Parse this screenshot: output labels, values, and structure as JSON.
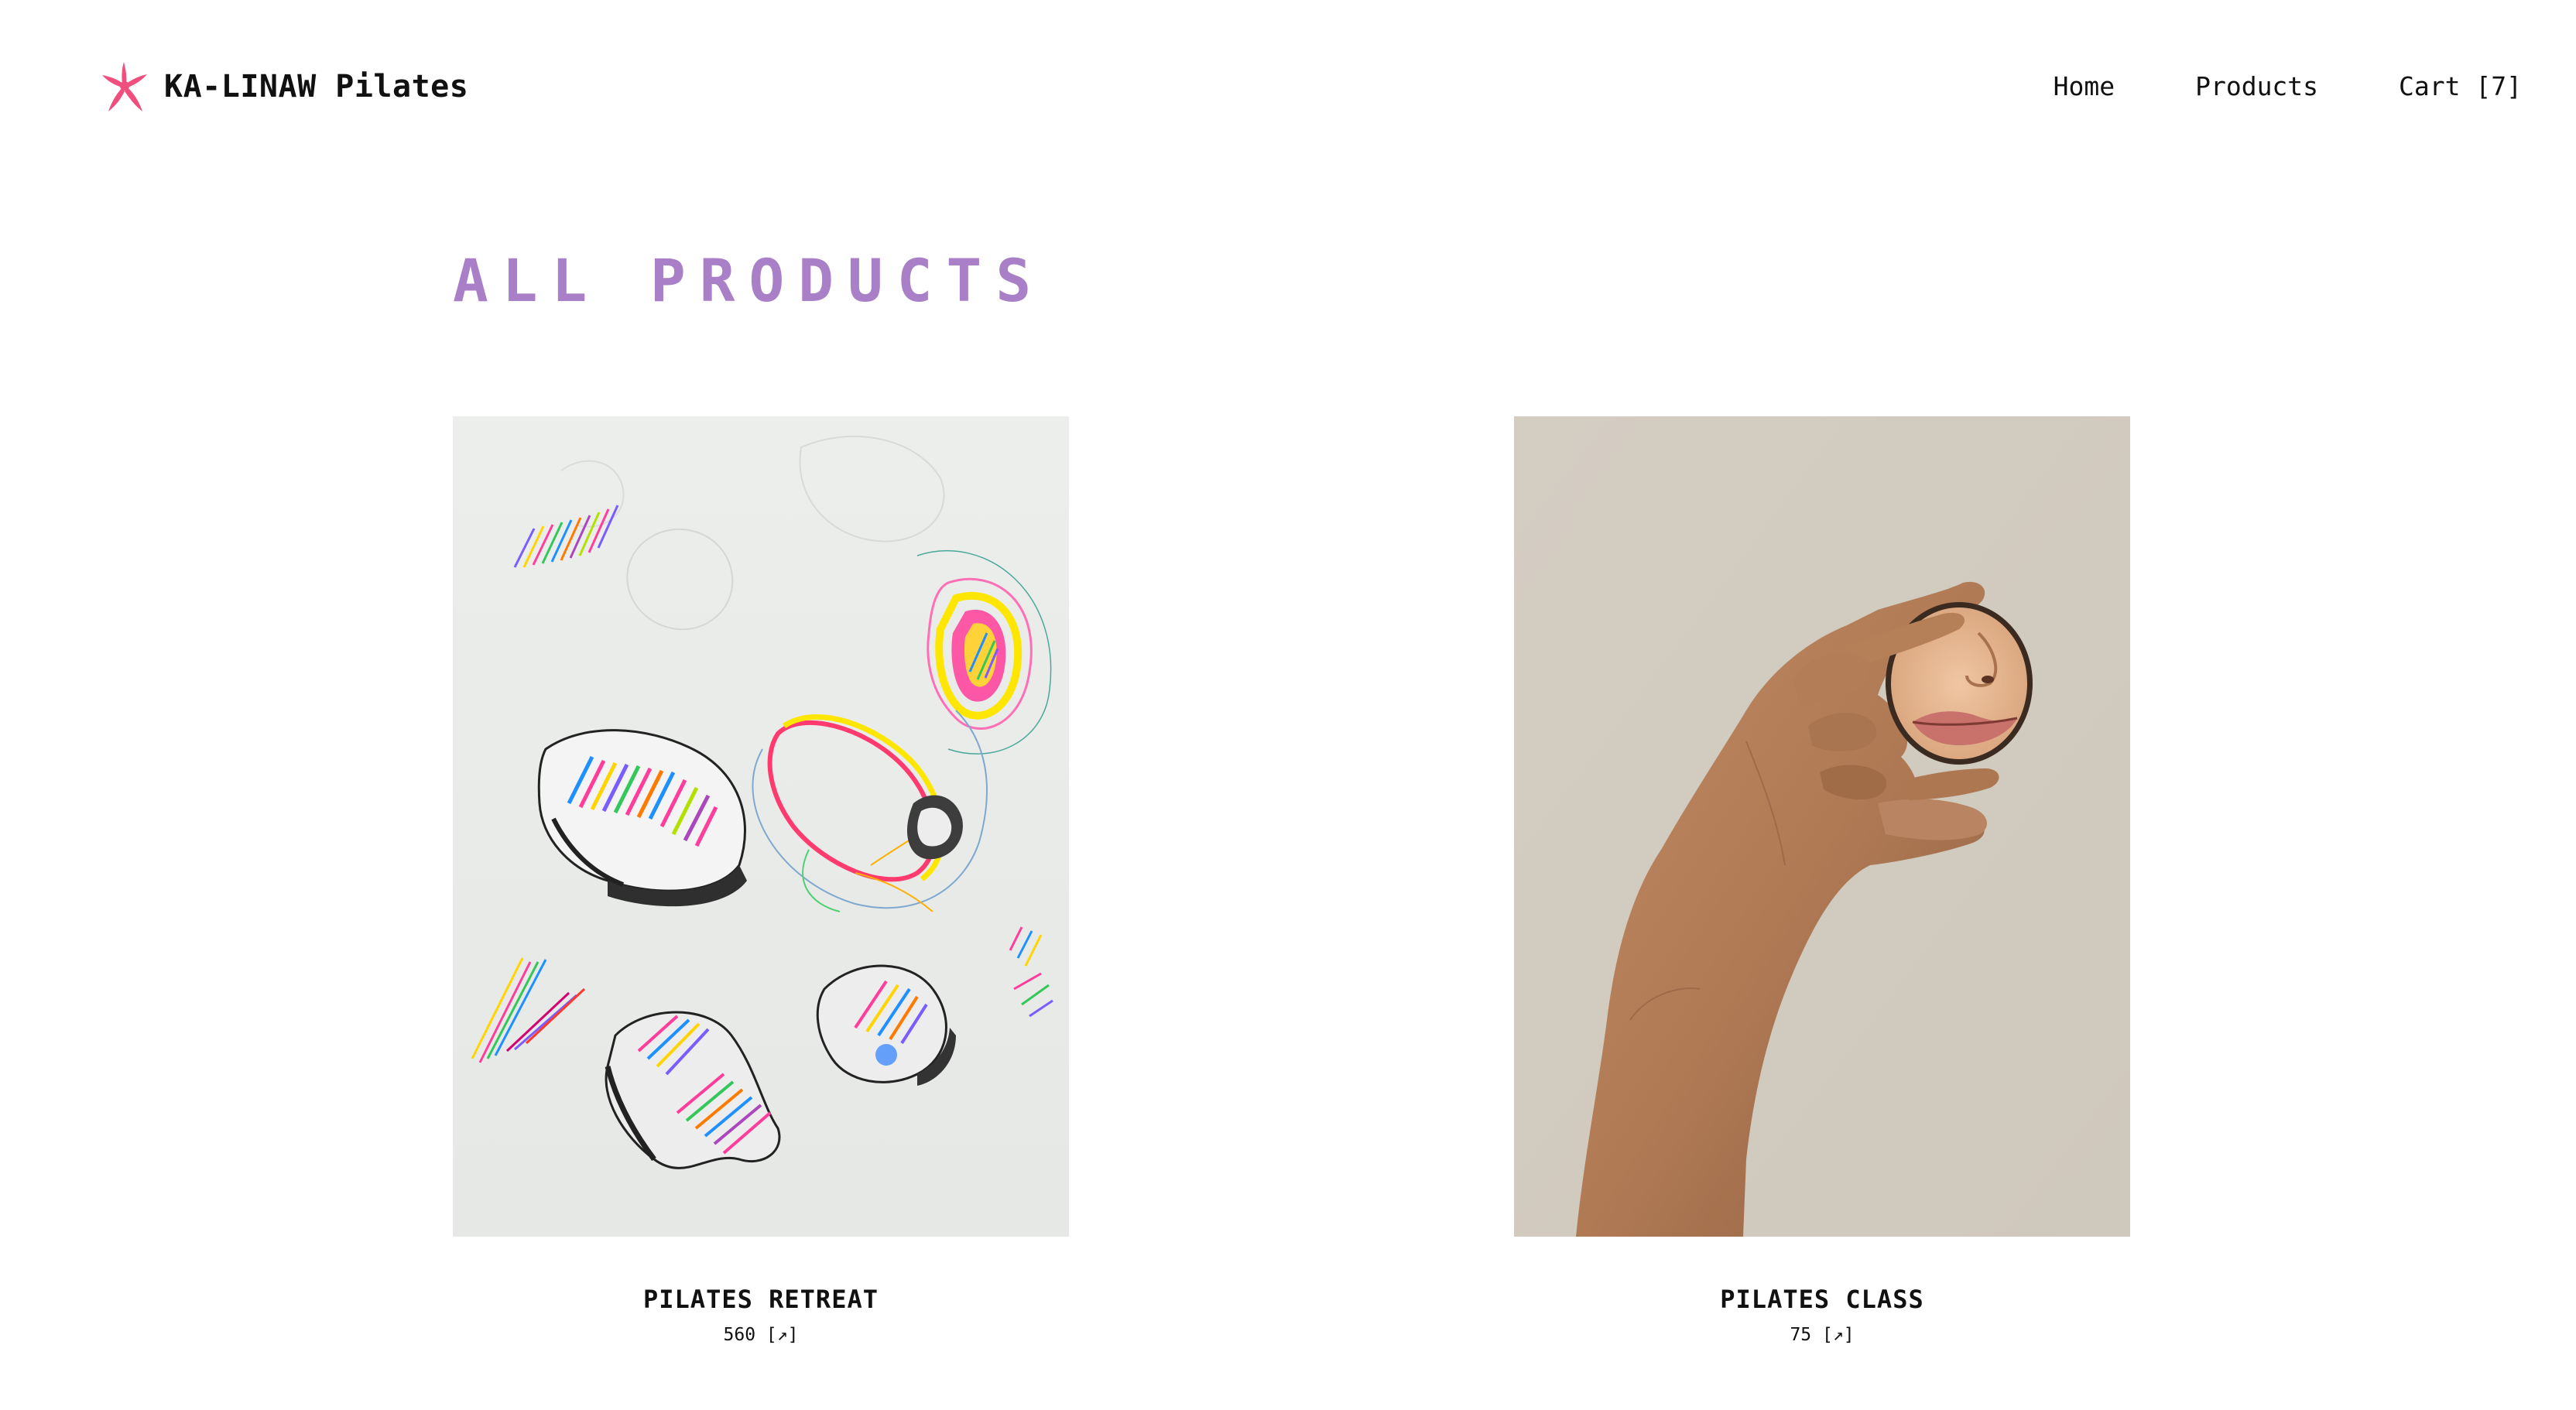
{
  "header": {
    "brand_name": "KA-LINAW Pilates",
    "logo_icon": "pink-asterisk-star-icon",
    "logo_color": "#ee4f7d",
    "nav": [
      {
        "label": "Home"
      },
      {
        "label": "Products"
      },
      {
        "label": "Cart [7]"
      }
    ]
  },
  "main": {
    "title": "ALL PRODUCTS",
    "title_color": "#a97fc7",
    "products": [
      {
        "name": "PILATES RETREAT",
        "price": "560 [↗]",
        "image": "abstract colorful stones drawing"
      },
      {
        "name": "PILATES CLASS",
        "price": "75 [↗]",
        "image": "hand holding round mirror reflecting lips"
      }
    ]
  }
}
